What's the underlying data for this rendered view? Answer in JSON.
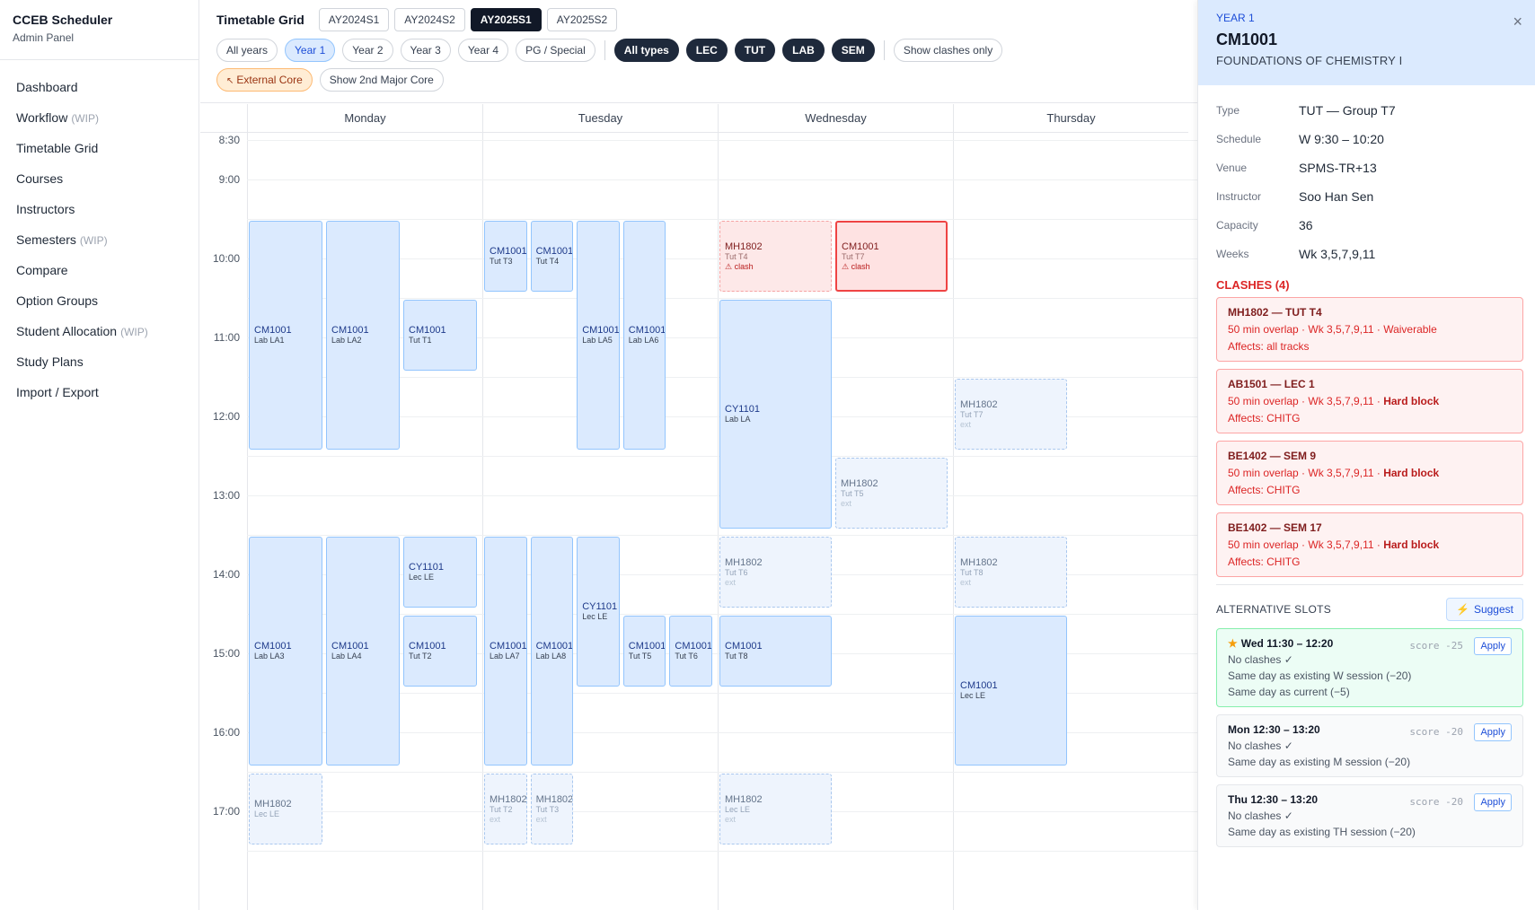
{
  "app": {
    "title": "CCEB Scheduler",
    "subtitle": "Admin Panel"
  },
  "sidebar": {
    "items": [
      {
        "label": "Dashboard",
        "tag": ""
      },
      {
        "label": "Workflow",
        "tag": "(WIP)"
      },
      {
        "label": "Timetable Grid",
        "tag": ""
      },
      {
        "label": "Courses",
        "tag": ""
      },
      {
        "label": "Instructors",
        "tag": ""
      },
      {
        "label": "Semesters",
        "tag": "(WIP)"
      },
      {
        "label": "Compare",
        "tag": ""
      },
      {
        "label": "Option Groups",
        "tag": ""
      },
      {
        "label": "Student Allocation",
        "tag": "(WIP)"
      },
      {
        "label": "Study Plans",
        "tag": ""
      },
      {
        "label": "Import / Export",
        "tag": ""
      }
    ]
  },
  "toolbar": {
    "title": "Timetable Grid",
    "semesters": [
      "AY2024S1",
      "AY2024S2",
      "AY2025S1",
      "AY2025S2"
    ],
    "selected_semester": "AY2025S1",
    "years": [
      "All years",
      "Year 1",
      "Year 2",
      "Year 3",
      "Year 4",
      "PG / Special"
    ],
    "selected_year": "Year 1",
    "types": [
      "All types",
      "LEC",
      "TUT",
      "LAB",
      "SEM"
    ],
    "show_clashes": "Show clashes only",
    "external_core": "External Core",
    "second_major": "Show 2nd Major Core"
  },
  "grid": {
    "days": [
      "Monday",
      "Tuesday",
      "Wednesday",
      "Thursday"
    ],
    "times": [
      "8:30",
      "9:00",
      "10:00",
      "11:00",
      "12:00",
      "13:00",
      "14:00",
      "15:00",
      "16:00",
      "17:00"
    ],
    "events": [
      {
        "day": 0,
        "lane": 0,
        "lanes": 3,
        "start": "9:30",
        "end": "12:20",
        "code": "CM1001",
        "group": "Lab LA1",
        "kind": "normal",
        "note": ""
      },
      {
        "day": 0,
        "lane": 1,
        "lanes": 3,
        "start": "9:30",
        "end": "12:20",
        "code": "CM1001",
        "group": "Lab LA2",
        "kind": "normal",
        "note": ""
      },
      {
        "day": 0,
        "lane": 2,
        "lanes": 3,
        "start": "10:30",
        "end": "11:20",
        "code": "CM1001",
        "group": "Tut T1",
        "kind": "normal",
        "note": ""
      },
      {
        "day": 0,
        "lane": 0,
        "lanes": 3,
        "start": "13:30",
        "end": "16:20",
        "code": "CM1001",
        "group": "Lab LA3",
        "kind": "normal",
        "note": ""
      },
      {
        "day": 0,
        "lane": 1,
        "lanes": 3,
        "start": "13:30",
        "end": "16:20",
        "code": "CM1001",
        "group": "Lab LA4",
        "kind": "normal",
        "note": ""
      },
      {
        "day": 0,
        "lane": 2,
        "lanes": 3,
        "start": "13:30",
        "end": "14:20",
        "code": "CY1101",
        "group": "Lec LE",
        "kind": "normal",
        "note": ""
      },
      {
        "day": 0,
        "lane": 2,
        "lanes": 3,
        "start": "14:30",
        "end": "15:20",
        "code": "CM1001",
        "group": "Tut T2",
        "kind": "normal",
        "note": ""
      },
      {
        "day": 0,
        "lane": 0,
        "lanes": 3,
        "start": "16:30",
        "end": "17:20",
        "code": "MH1802",
        "group": "Lec LE",
        "kind": "ext",
        "note": ""
      },
      {
        "day": 1,
        "lane": 0,
        "lanes": 5,
        "start": "9:30",
        "end": "10:20",
        "code": "CM1001",
        "group": "Tut T3",
        "kind": "normal",
        "note": ""
      },
      {
        "day": 1,
        "lane": 1,
        "lanes": 5,
        "start": "9:30",
        "end": "10:20",
        "code": "CM1001",
        "group": "Tut T4",
        "kind": "normal",
        "note": ""
      },
      {
        "day": 1,
        "lane": 2,
        "lanes": 5,
        "start": "9:30",
        "end": "12:20",
        "code": "CM1001",
        "group": "Lab LA5",
        "kind": "normal",
        "note": ""
      },
      {
        "day": 1,
        "lane": 3,
        "lanes": 5,
        "start": "9:30",
        "end": "12:20",
        "code": "CM1001",
        "group": "Lab LA6",
        "kind": "normal",
        "note": ""
      },
      {
        "day": 1,
        "lane": 0,
        "lanes": 5,
        "start": "13:30",
        "end": "16:20",
        "code": "CM1001",
        "group": "Lab LA7",
        "kind": "normal",
        "note": ""
      },
      {
        "day": 1,
        "lane": 1,
        "lanes": 5,
        "start": "13:30",
        "end": "16:20",
        "code": "CM1001",
        "group": "Lab LA8",
        "kind": "normal",
        "note": ""
      },
      {
        "day": 1,
        "lane": 2,
        "lanes": 5,
        "start": "13:30",
        "end": "15:20",
        "code": "CY1101",
        "group": "Lec LE",
        "kind": "normal",
        "note": ""
      },
      {
        "day": 1,
        "lane": 3,
        "lanes": 5,
        "start": "14:30",
        "end": "15:20",
        "code": "CM1001",
        "group": "Tut T5",
        "kind": "normal",
        "note": ""
      },
      {
        "day": 1,
        "lane": 4,
        "lanes": 5,
        "start": "14:30",
        "end": "15:20",
        "code": "CM1001",
        "group": "Tut T6",
        "kind": "normal",
        "note": ""
      },
      {
        "day": 1,
        "lane": 0,
        "lanes": 5,
        "start": "16:30",
        "end": "17:20",
        "code": "MH1802",
        "group": "Tut T2",
        "kind": "ext",
        "note": "ext"
      },
      {
        "day": 1,
        "lane": 1,
        "lanes": 5,
        "start": "16:30",
        "end": "17:20",
        "code": "MH1802",
        "group": "Tut T3",
        "kind": "ext",
        "note": "ext"
      },
      {
        "day": 2,
        "lane": 0,
        "lanes": 2,
        "start": "9:30",
        "end": "10:20",
        "code": "MH1802",
        "group": "Tut T4",
        "kind": "clash",
        "note": "⚠ clash"
      },
      {
        "day": 2,
        "lane": 1,
        "lanes": 2,
        "start": "9:30",
        "end": "10:20",
        "code": "CM1001",
        "group": "Tut T7",
        "kind": "sel",
        "note": "⚠ clash"
      },
      {
        "day": 2,
        "lane": 0,
        "lanes": 2,
        "start": "10:30",
        "end": "13:20",
        "code": "CY1101",
        "group": "Lab LA",
        "kind": "normal",
        "note": ""
      },
      {
        "day": 2,
        "lane": 1,
        "lanes": 2,
        "start": "12:30",
        "end": "13:20",
        "code": "MH1802",
        "group": "Tut T5",
        "kind": "ext",
        "note": "ext"
      },
      {
        "day": 2,
        "lane": 0,
        "lanes": 2,
        "start": "13:30",
        "end": "14:20",
        "code": "MH1802",
        "group": "Tut T6",
        "kind": "ext",
        "note": "ext"
      },
      {
        "day": 2,
        "lane": 0,
        "lanes": 2,
        "start": "14:30",
        "end": "15:20",
        "code": "CM1001",
        "group": "Tut T8",
        "kind": "normal",
        "note": ""
      },
      {
        "day": 2,
        "lane": 0,
        "lanes": 2,
        "start": "16:30",
        "end": "17:20",
        "code": "MH1802",
        "group": "Lec LE",
        "kind": "ext",
        "note": "ext"
      },
      {
        "day": 3,
        "lane": 0,
        "lanes": 2,
        "start": "11:30",
        "end": "12:20",
        "code": "MH1802",
        "group": "Tut T7",
        "kind": "ext",
        "note": "ext"
      },
      {
        "day": 3,
        "lane": 0,
        "lanes": 2,
        "start": "13:30",
        "end": "14:20",
        "code": "MH1802",
        "group": "Tut T8",
        "kind": "ext",
        "note": "ext"
      },
      {
        "day": 3,
        "lane": 0,
        "lanes": 2,
        "start": "14:30",
        "end": "16:20",
        "code": "CM1001",
        "group": "Lec LE",
        "kind": "normal",
        "note": ""
      }
    ]
  },
  "panel": {
    "year": "YEAR 1",
    "code": "CM1001",
    "name": "FOUNDATIONS OF CHEMISTRY I",
    "close": "×",
    "details": [
      {
        "label": "Type",
        "value": "TUT — Group T7"
      },
      {
        "label": "Schedule",
        "value": "W 9:30 – 10:20"
      },
      {
        "label": "Venue",
        "value": "SPMS-TR+13"
      },
      {
        "label": "Instructor",
        "value": "Soo Han Sen"
      },
      {
        "label": "Capacity",
        "value": "36"
      },
      {
        "label": "Weeks",
        "value": "Wk 3,5,7,9,11"
      }
    ],
    "clashes_title": "CLASHES (4)",
    "clashes": [
      {
        "title": "MH1802 — TUT T4",
        "detail": "50 min overlap · Wk 3,5,7,9,11 · ",
        "severity": "Waiverable",
        "hard": false,
        "affects": "Affects: all tracks"
      },
      {
        "title": "AB1501 — LEC 1",
        "detail": "50 min overlap · Wk 3,5,7,9,11 · ",
        "severity": "Hard block",
        "hard": true,
        "affects": "Affects: CHITG"
      },
      {
        "title": "BE1402 — SEM 9",
        "detail": "50 min overlap · Wk 3,5,7,9,11 · ",
        "severity": "Hard block",
        "hard": true,
        "affects": "Affects: CHITG"
      },
      {
        "title": "BE1402 — SEM 17",
        "detail": "50 min overlap · Wk 3,5,7,9,11 · ",
        "severity": "Hard block",
        "hard": true,
        "affects": "Affects: CHITG"
      }
    ],
    "alt_title": "ALTERNATIVE SLOTS",
    "suggest": "Suggest",
    "alternatives": [
      {
        "time": "Wed 11:30 – 12:20",
        "best": true,
        "score": "score -25",
        "apply": "Apply",
        "lines": [
          "No clashes ✓",
          "Same day as existing W session (−20)",
          "Same day as current (−5)"
        ]
      },
      {
        "time": "Mon 12:30 – 13:20",
        "best": false,
        "score": "score -20",
        "apply": "Apply",
        "lines": [
          "No clashes ✓",
          "Same day as existing M session (−20)"
        ]
      },
      {
        "time": "Thu 12:30 – 13:20",
        "best": false,
        "score": "score -20",
        "apply": "Apply",
        "lines": [
          "No clashes ✓",
          "Same day as existing TH session (−20)"
        ]
      }
    ]
  }
}
